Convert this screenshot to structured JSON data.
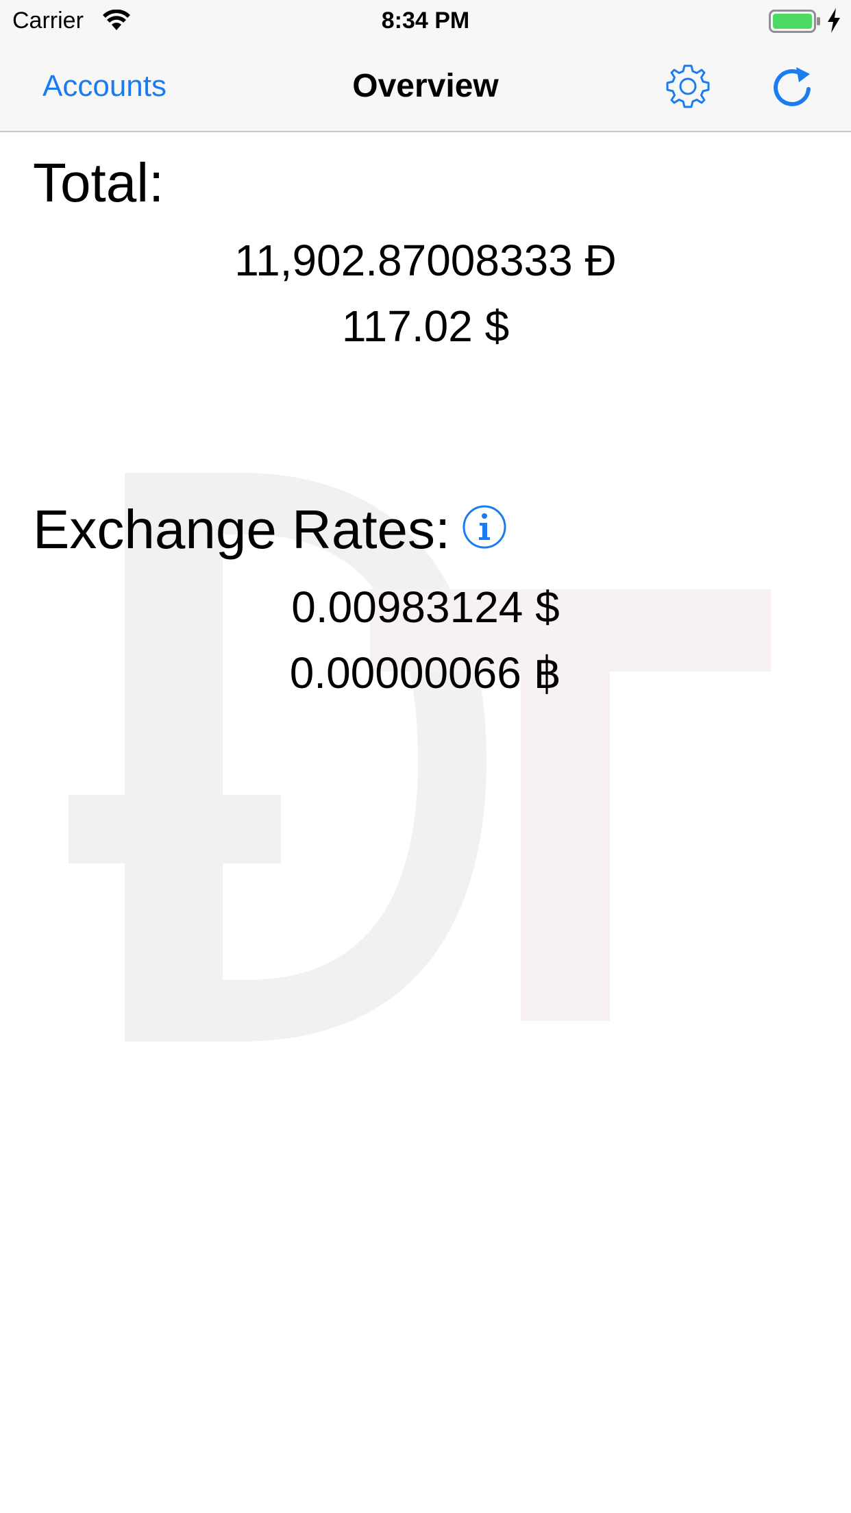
{
  "status_bar": {
    "carrier": "Carrier",
    "time": "8:34 PM",
    "battery_color": "#4cd964",
    "wifi_icon": "wifi-icon",
    "battery_icon": "battery-icon",
    "charging_icon": "bolt-icon"
  },
  "nav": {
    "back_label": "Accounts",
    "title": "Overview",
    "settings_icon": "gear-icon",
    "refresh_icon": "refresh-icon",
    "accent_color": "#1a7cf0"
  },
  "total": {
    "heading": "Total:",
    "coin_amount": "11,902.87008333 Đ",
    "usd_amount": "117.02 $"
  },
  "exchange_rates": {
    "heading": "Exchange Rates:",
    "info_icon": "info-icon",
    "usd_rate": "0.00983124 $",
    "btc_rate": "0.00000066 ฿"
  },
  "watermark": {
    "glyphs": "ĐT"
  }
}
